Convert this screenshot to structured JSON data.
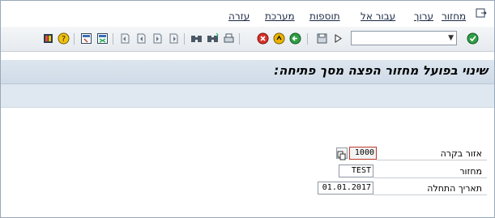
{
  "menu": {
    "items": [
      "מחזור",
      "ערוך",
      "עבור אל",
      "תוספות",
      "מערכת",
      "עזרה"
    ]
  },
  "toolbar": {
    "command_field": ""
  },
  "title": "שינוי בפועל מחזור הפצה מסך פתיחה:",
  "form": {
    "fields": [
      {
        "label": "אזור בקרה",
        "value": "1000"
      },
      {
        "label": "מחזור",
        "value": "TEST"
      },
      {
        "label": "תאריך התחלה",
        "value": "01.01.2017"
      }
    ]
  },
  "colors": {
    "title_bar": "#d6e0eb",
    "app_toolbar": "#dfe7f0",
    "required_marker": "#c0392b"
  }
}
